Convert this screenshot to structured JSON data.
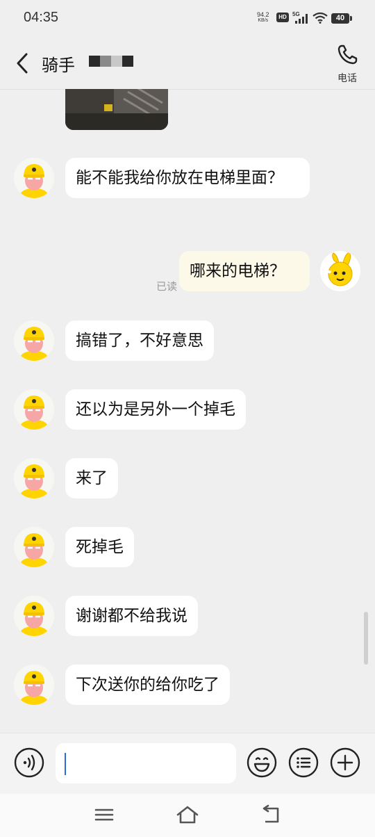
{
  "status_bar": {
    "time": "04:35",
    "net_speed_value": "94.2",
    "net_speed_unit": "KB/s",
    "hd_badge": "HD",
    "signal_label": "5G",
    "battery": "40"
  },
  "header": {
    "title": "骑手",
    "call_label": "电话"
  },
  "messages": [
    {
      "from": "rider",
      "text": "能不能我给你放在电梯里面？"
    },
    {
      "from": "me",
      "text": "哪来的电梯？",
      "status": "已读"
    },
    {
      "from": "rider",
      "text": "搞错了，不好意思"
    },
    {
      "from": "rider",
      "text": "还以为是另外一个掉毛"
    },
    {
      "from": "rider",
      "text": "来了"
    },
    {
      "from": "rider",
      "text": "死掉毛"
    },
    {
      "from": "rider",
      "text": "谢谢都不给我说"
    },
    {
      "from": "rider",
      "text": "下次送你的给你吃了"
    }
  ],
  "input_bar": {
    "voice_icon": "voice-icon",
    "emoji_icon": "emoji-icon",
    "more_icon": "quick-reply-icon",
    "plus_icon": "plus-icon"
  },
  "colors": {
    "background": "#efefef",
    "bubble_in": "#ffffff",
    "bubble_out": "#fdf9e8",
    "avatar_yellow": "#ffd400",
    "cursor": "#2a6bd8"
  }
}
